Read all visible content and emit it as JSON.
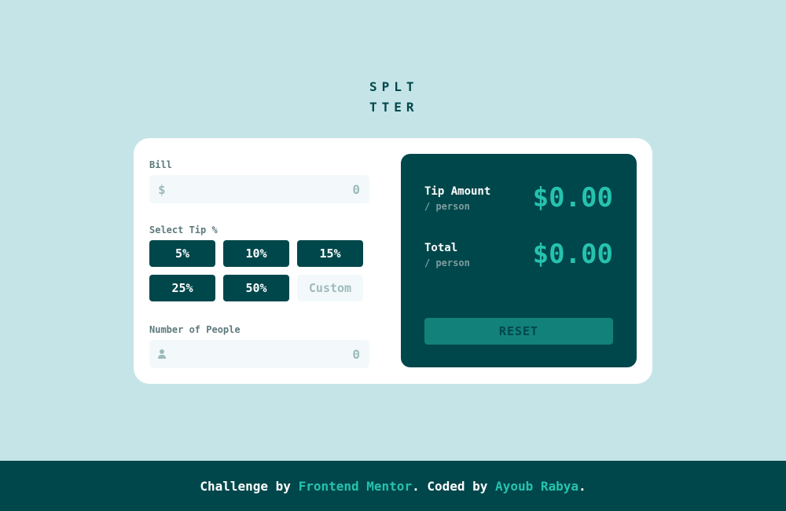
{
  "logo": {
    "line1": "SPLT",
    "line2": "TTER"
  },
  "bill": {
    "label": "Bill",
    "currency_symbol": "$",
    "value": "0"
  },
  "tip": {
    "label": "Select Tip %",
    "options": [
      "5%",
      "10%",
      "15%",
      "25%",
      "50%"
    ],
    "custom_placeholder": "Custom"
  },
  "people": {
    "label": "Number of People",
    "value": "0"
  },
  "results": {
    "tip_amount_label": "Tip Amount",
    "tip_amount_sub": "/ person",
    "tip_amount_value": "$0.00",
    "total_label": "Total",
    "total_sub": "/ person",
    "total_value": "$0.00",
    "reset_label": "RESET"
  },
  "footer": {
    "prefix": "Challenge by ",
    "link1": "Frontend Mentor",
    "middle": ". Coded by ",
    "link2": "Ayoub Rabya",
    "suffix": "."
  },
  "colors": {
    "background": "#c5e4e7",
    "dark_cyan": "#00474b",
    "accent": "#26c2ae",
    "reset_bg": "#128179",
    "input_bg": "#f3f9fa"
  }
}
